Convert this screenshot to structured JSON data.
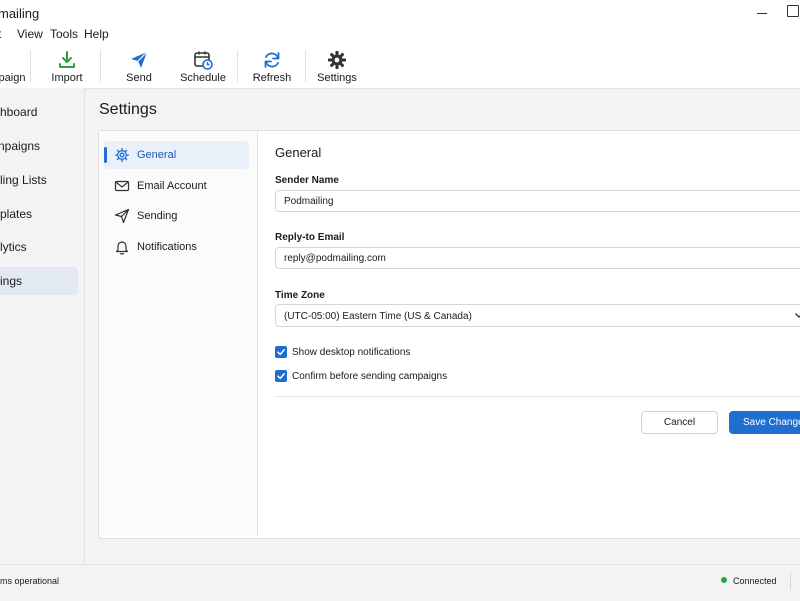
{
  "window": {
    "title": "mailing"
  },
  "menu": [
    "t",
    "View",
    "Tools",
    "Help"
  ],
  "toolbar": [
    {
      "label": "paign",
      "icon": "new-campaign-icon"
    },
    {
      "label": "Import",
      "icon": "download-icon",
      "color": "#2e9e44"
    },
    {
      "label": "Send",
      "icon": "send-icon",
      "color": "#1f6fd1"
    },
    {
      "label": "Schedule",
      "icon": "calendar-clock-icon"
    },
    {
      "label": "Refresh",
      "icon": "refresh-icon",
      "color": "#1f6fd1"
    },
    {
      "label": "Settings",
      "icon": "gear-icon"
    }
  ],
  "nav": [
    {
      "label": "hboard"
    },
    {
      "label": "npaigns"
    },
    {
      "label": "ling Lists"
    },
    {
      "label": "plates"
    },
    {
      "label": "lytics"
    },
    {
      "label": "ings",
      "active": true
    }
  ],
  "page": {
    "title": "Settings"
  },
  "settings_menu": [
    {
      "label": "General",
      "icon": "gear-icon",
      "active": true
    },
    {
      "label": "Email Account",
      "icon": "envelope-icon"
    },
    {
      "label": "Sending",
      "icon": "send-icon"
    },
    {
      "label": "Notifications",
      "icon": "bell-icon"
    }
  ],
  "general": {
    "title": "General",
    "sender_name_label": "Sender Name",
    "sender_name_value": "Podmailing",
    "reply_to_label": "Reply-to Email",
    "reply_to_value": "reply@podmailing.com",
    "timezone_label": "Time Zone",
    "timezone_value": "(UTC-05:00) Eastern Time (US & Canada)",
    "checkbox_desktop": "Show desktop notifications",
    "checkbox_desktop_checked": true,
    "checkbox_confirm": "Confirm before sending campaigns",
    "checkbox_confirm_checked": true,
    "cancel_label": "Cancel",
    "save_label": "Save Changes"
  },
  "status": {
    "text": "ems operational",
    "connection": "Connected",
    "connection_color": "#22a447"
  },
  "colors": {
    "accent": "#1f6fd1"
  }
}
